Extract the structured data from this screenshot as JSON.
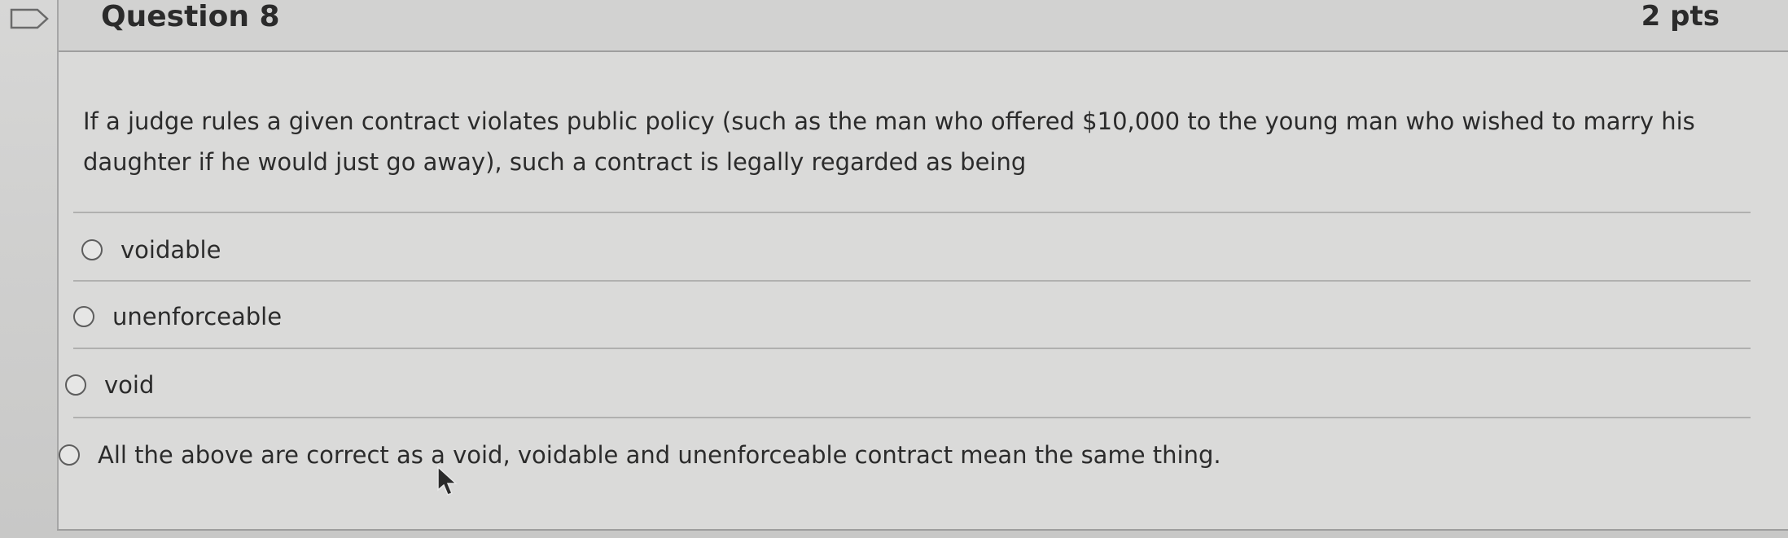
{
  "question": {
    "title": "Question 8",
    "points": "2 pts",
    "text": "If a judge rules a given contract violates public policy (such as the man who offered $10,000 to the young man who wished to marry his daughter if he would just go away), such a contract is legally regarded as being"
  },
  "answers": [
    {
      "label": "voidable",
      "selected": false
    },
    {
      "label": "unenforceable",
      "selected": false
    },
    {
      "label": "void",
      "selected": false
    },
    {
      "label": "All the above are correct as a void, voidable and unenforceable contract mean the same thing.",
      "selected": false
    }
  ],
  "icons": {
    "flag": "flag-icon",
    "cursor": "mouse-pointer-icon",
    "radio": "radio-unselected-icon"
  },
  "colors": {
    "background": "#cfcfcf",
    "card": "#dadad9",
    "text": "#2b2b2b",
    "radio_border": "#5d5d5d"
  }
}
